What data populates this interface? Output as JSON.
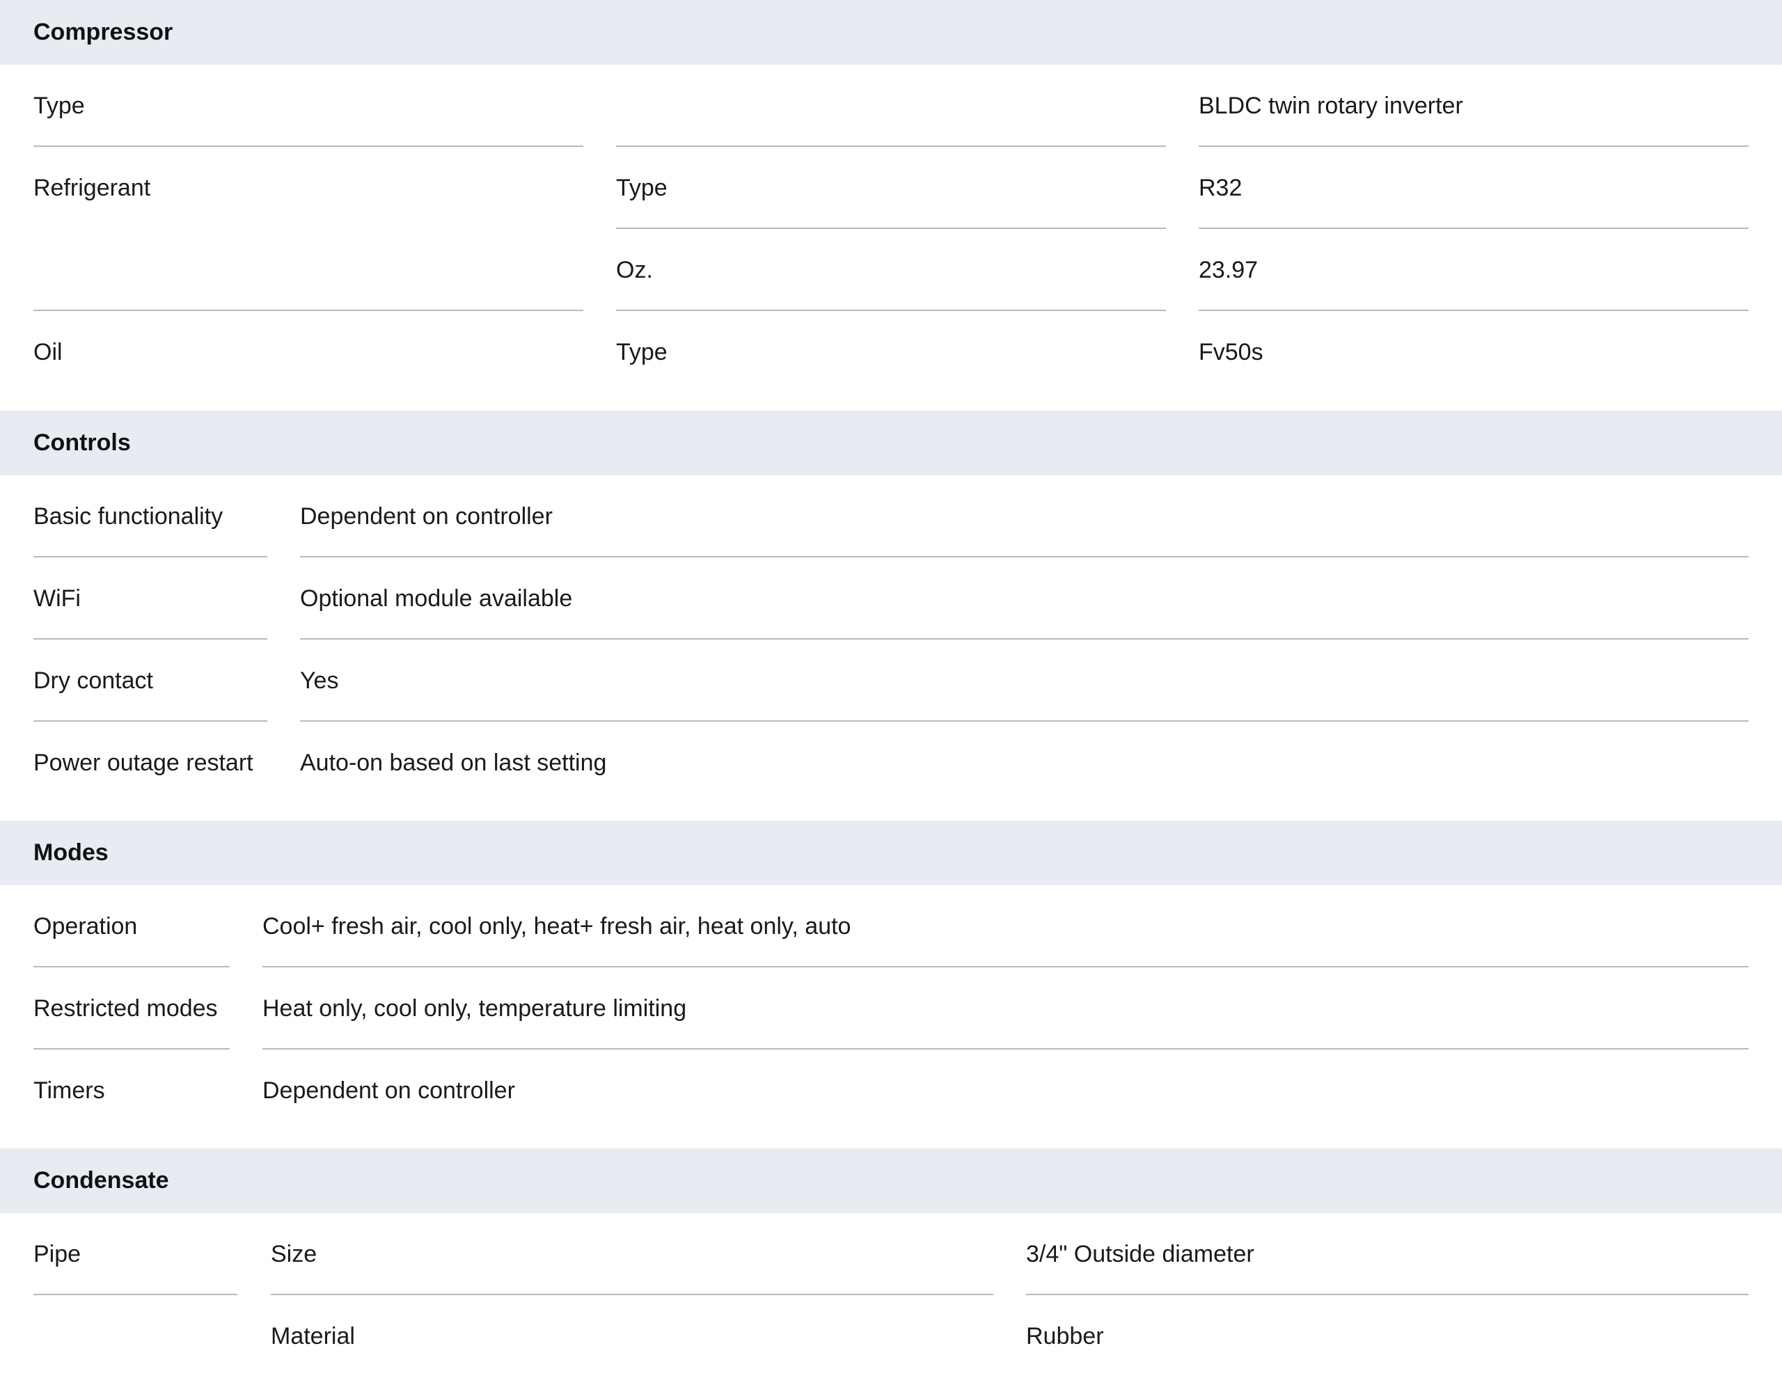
{
  "sections": {
    "compressor": {
      "title": "Compressor",
      "rows": [
        {
          "label": "Type",
          "sub": "",
          "value": "BLDC twin rotary inverter"
        },
        {
          "label": "Refrigerant",
          "sub": "Type",
          "value": "R32"
        },
        {
          "label": "",
          "sub": "Oz.",
          "value": "23.97"
        },
        {
          "label": "Oil",
          "sub": "Type",
          "value": "Fv50s"
        }
      ]
    },
    "controls": {
      "title": "Controls",
      "rows": [
        {
          "label": "Basic functionality",
          "value": "Dependent on controller"
        },
        {
          "label": "WiFi",
          "value": "Optional module available"
        },
        {
          "label": "Dry contact",
          "value": "Yes"
        },
        {
          "label": "Power outage restart",
          "value": "Auto-on based on last setting"
        }
      ]
    },
    "modes": {
      "title": "Modes",
      "rows": [
        {
          "label": "Operation",
          "value": "Cool+ fresh air, cool only, heat+ fresh air, heat only, auto"
        },
        {
          "label": "Restricted modes",
          "value": "Heat only, cool only, temperature limiting"
        },
        {
          "label": "Timers",
          "value": "Dependent on controller"
        }
      ]
    },
    "condensate": {
      "title": "Condensate",
      "rows": [
        {
          "label": "Pipe",
          "sub": "Size",
          "value": "3/4\" Outside diameter"
        },
        {
          "label": "",
          "sub": "Material",
          "value": "Rubber"
        }
      ]
    }
  }
}
